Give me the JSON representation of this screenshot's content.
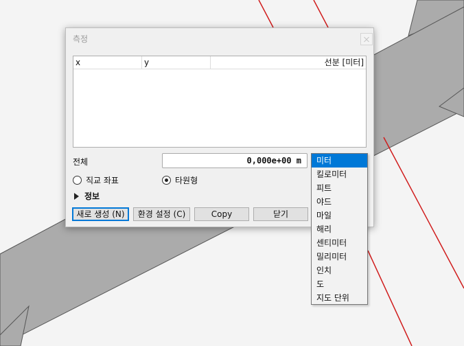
{
  "dialog": {
    "title": "측정"
  },
  "table": {
    "columns": [
      "x",
      "y",
      "선분 [미터]"
    ],
    "rows": []
  },
  "total": {
    "label": "전체",
    "value": "0,000e+00 m",
    "unit_selected": "미터"
  },
  "coords": {
    "options": [
      "직교 좌표",
      "타원형"
    ],
    "selected": "타원형"
  },
  "info": {
    "label": "정보"
  },
  "buttons": {
    "new": "새로 생성 (N)",
    "settings": "환경 설정 (C)",
    "copy": "Copy",
    "close": "닫기"
  },
  "unit_options": [
    "미터",
    "킬로미터",
    "피트",
    "야드",
    "마일",
    "해리",
    "센티미터",
    "밀리미터",
    "인치",
    "도",
    "지도 단위"
  ],
  "colors": {
    "accent": "#0078d7",
    "map_polygon": "#ababab",
    "map_line": "#d01c1c"
  }
}
